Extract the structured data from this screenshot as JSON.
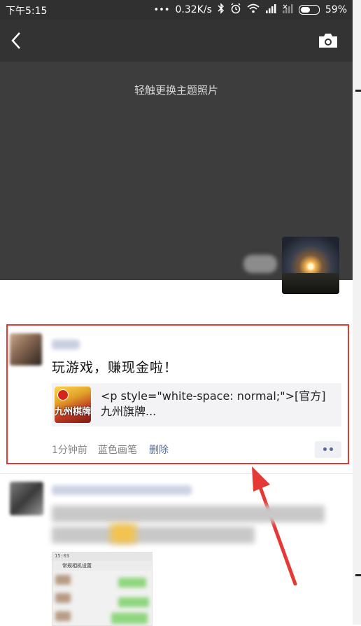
{
  "status_bar": {
    "time": "下午5:15",
    "dots": "•••",
    "network_speed": "0.32K/s",
    "battery_percent": "59%",
    "battery_level": 0.59,
    "icons": [
      "bluetooth-icon",
      "alarm-icon",
      "wifi-icon",
      "signal-icon",
      "signal-icon",
      "battery-icon"
    ]
  },
  "header": {
    "cover_hint": "轻触更换主题照片",
    "back_icon": "chevron-left-icon",
    "camera_icon": "camera-icon"
  },
  "post1": {
    "text": "玩游戏，赚现金啦！",
    "link_title": "<p style=\"white-space: normal;\">[官方]九州旗牌...",
    "thumb_label": "九州棋牌",
    "time": "1分钟前",
    "author_label": "蓝色画笔",
    "delete_label": "删除",
    "highlight_color": "#e53935"
  },
  "post2": {
    "screenshot_time": "15:03",
    "screenshot_title": "常规相机设置"
  },
  "colors": {
    "link_blue": "#576b95",
    "cover_bg": "#3d3d3d",
    "annotation_red": "#e53935"
  }
}
